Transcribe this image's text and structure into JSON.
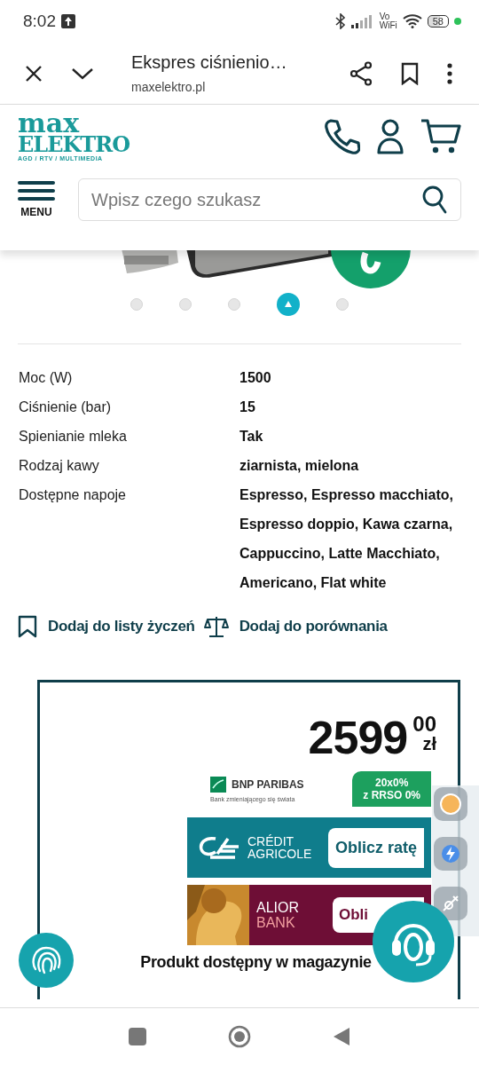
{
  "status_bar": {
    "time": "8:02",
    "vowifi": [
      "Vo",
      "WiFi"
    ],
    "battery": "58"
  },
  "browser": {
    "title": "Ekspres ciśnienio…",
    "url": "maxelektro.pl"
  },
  "logo": {
    "top": "max",
    "main": "ELEKTRO",
    "tagline": "AGD / RTV / MULTIMEDIA"
  },
  "menu_label": "MENU",
  "search": {
    "placeholder": "Wpisz czego szukasz"
  },
  "carousel_dots": [
    {
      "selected": false
    },
    {
      "selected": false
    },
    {
      "selected": false
    },
    {
      "selected": true
    },
    {
      "selected": false
    }
  ],
  "specs": [
    {
      "label": "Moc (W)",
      "value": "1500"
    },
    {
      "label": "Ciśnienie (bar)",
      "value": "15"
    },
    {
      "label": "Spienianie mleka",
      "value": "Tak"
    },
    {
      "label": "Rodzaj kawy",
      "value": "ziarnista, mielona"
    },
    {
      "label": "Dostępne napoje",
      "value": "Espresso, Espresso macchiato, Espresso doppio, Kawa czarna, Cappuccino, Latte Macchiato, Americano, Flat white"
    }
  ],
  "actions": [
    {
      "kind": "wishlist",
      "label": "Dodaj do listy życzeń"
    },
    {
      "kind": "compare",
      "label": "Dodaj do porównania"
    }
  ],
  "price": {
    "amount": "2599",
    "decimals": "00",
    "currency": "zł"
  },
  "banners": [
    {
      "kind": "bnp",
      "brand": "BNP PARIBAS",
      "slogan": "Bank zmieniającego się świata",
      "offer": [
        "20x0%",
        "z RRSO 0%"
      ]
    },
    {
      "kind": "ca",
      "brand": [
        "CRÉDIT",
        "AGRICOLE"
      ],
      "offer": [
        "Oblicz ratę"
      ]
    },
    {
      "kind": "alior",
      "brand": [
        "ALIOR",
        "BANK"
      ],
      "offer": [
        "Obli"
      ]
    }
  ],
  "availability": "Produkt dostępny w magazynie"
}
